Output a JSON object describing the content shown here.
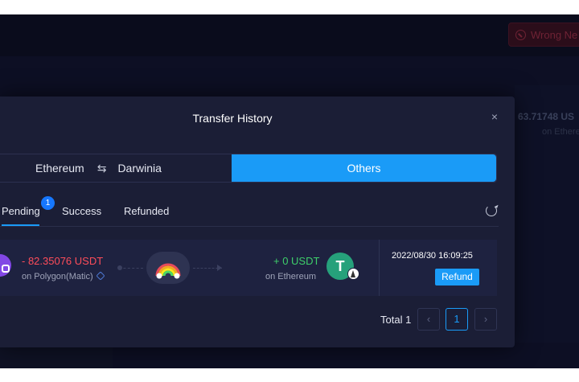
{
  "header": {
    "wrong_network_label": "Wrong Ne"
  },
  "background": {
    "balance_amount": "63.71748 US",
    "balance_network": "on Ethere"
  },
  "modal": {
    "title": "Transfer History",
    "close_symbol": "×",
    "direction_toggle": {
      "from_network": "Ethereum",
      "swap_symbol": "⇆",
      "to_network": "Darwinia",
      "others_label": "Others"
    },
    "tabs": [
      {
        "label": "Pending",
        "badge": "1",
        "active": true
      },
      {
        "label": "Success",
        "active": false
      },
      {
        "label": "Refunded",
        "active": false
      }
    ],
    "records": [
      {
        "from_amount": "- 82.35076 USDT",
        "from_network": "on Polygon(Matic)",
        "to_amount": "+ 0 USDT",
        "to_network": "on Ethereum",
        "to_token_symbol": "T",
        "timestamp": "2022/08/30 16:09:25",
        "action_label": "Refund"
      }
    ],
    "pagination": {
      "total_label": "Total 1",
      "prev_symbol": "‹",
      "current_page": "1",
      "next_symbol": "›"
    }
  },
  "colors": {
    "accent": "#1a9bf7",
    "negative": "#ff4d5a",
    "positive": "#3ecf6a",
    "badge": "#1677ff",
    "usdt": "#26a17b",
    "polygon": "#8247e5"
  }
}
